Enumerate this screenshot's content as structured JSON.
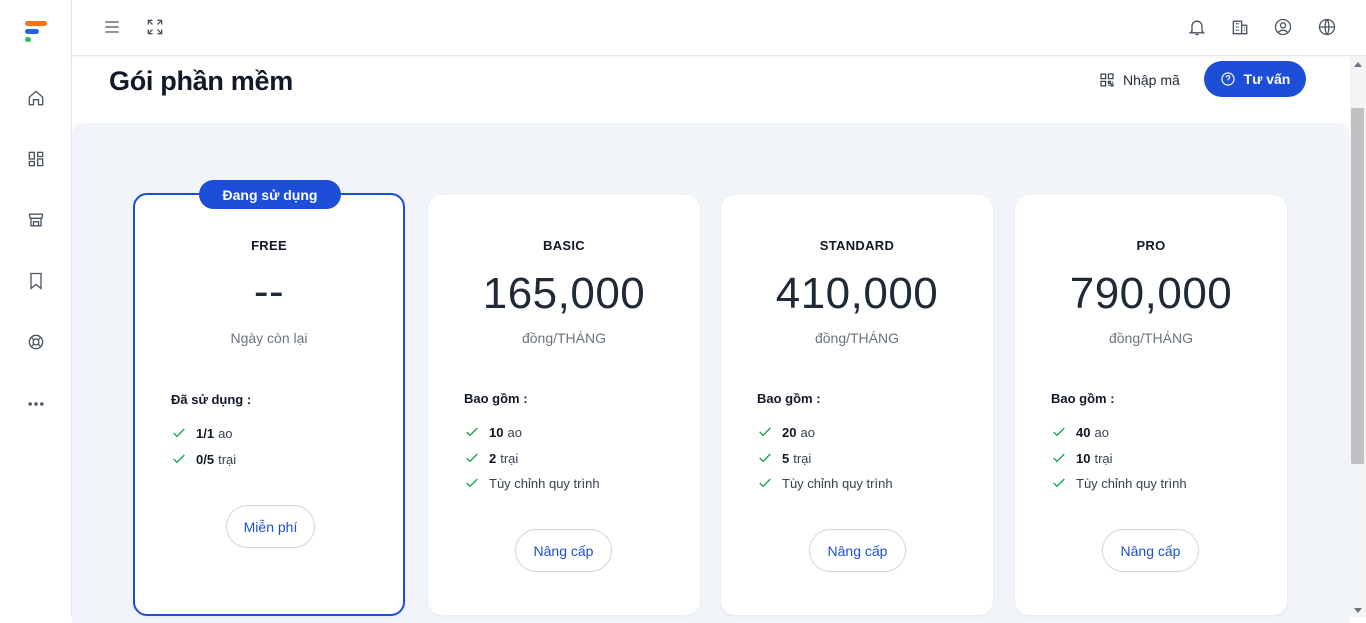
{
  "header": {
    "title": "Gói phần mềm",
    "enter_code_label": "Nhập mã",
    "consult_label": "Tư vấn"
  },
  "sidebar": {
    "items": [
      {
        "icon": "home-icon"
      },
      {
        "icon": "dashboard-icon"
      },
      {
        "icon": "store-icon"
      },
      {
        "icon": "bookmark-icon"
      },
      {
        "icon": "support-icon"
      },
      {
        "icon": "more-icon"
      }
    ]
  },
  "topbar": {
    "icons": [
      "menu-icon",
      "fullscreen-icon",
      "bell-icon",
      "building-icon",
      "user-icon",
      "globe-icon"
    ]
  },
  "plans": [
    {
      "badge": "Đang sử dụng",
      "name": "FREE",
      "price": "--",
      "price_sub": "Ngày còn lại",
      "included_label": "Đã sử dụng :",
      "features": [
        {
          "bold": "1/1",
          "text": "ao"
        },
        {
          "bold": "0/5",
          "text": "trại"
        }
      ],
      "button": "Miễn phí"
    },
    {
      "name": "BASIC",
      "price": "165,000",
      "price_sub": "đồng/THÁNG",
      "included_label": "Bao gồm :",
      "features": [
        {
          "bold": "10",
          "text": "ao"
        },
        {
          "bold": "2",
          "text": "trại"
        },
        {
          "bold": "",
          "text": "Tùy chỉnh quy trình"
        }
      ],
      "button": "Nâng cấp"
    },
    {
      "name": "STANDARD",
      "price": "410,000",
      "price_sub": "đồng/THÁNG",
      "included_label": "Bao gồm :",
      "features": [
        {
          "bold": "20",
          "text": "ao"
        },
        {
          "bold": "5",
          "text": "trại"
        },
        {
          "bold": "",
          "text": "Tùy chỉnh quy trình"
        }
      ],
      "button": "Nâng cấp"
    },
    {
      "name": "PRO",
      "price": "790,000",
      "price_sub": "đồng/THÁNG",
      "included_label": "Bao gồm :",
      "features": [
        {
          "bold": "40",
          "text": "ao"
        },
        {
          "bold": "10",
          "text": "trại"
        },
        {
          "bold": "",
          "text": "Tùy chỉnh quy trình"
        }
      ],
      "button": "Nâng cấp"
    }
  ],
  "colors": {
    "accent": "#1d4ed8",
    "check": "#16a34a",
    "background": "#f1f4f8"
  }
}
